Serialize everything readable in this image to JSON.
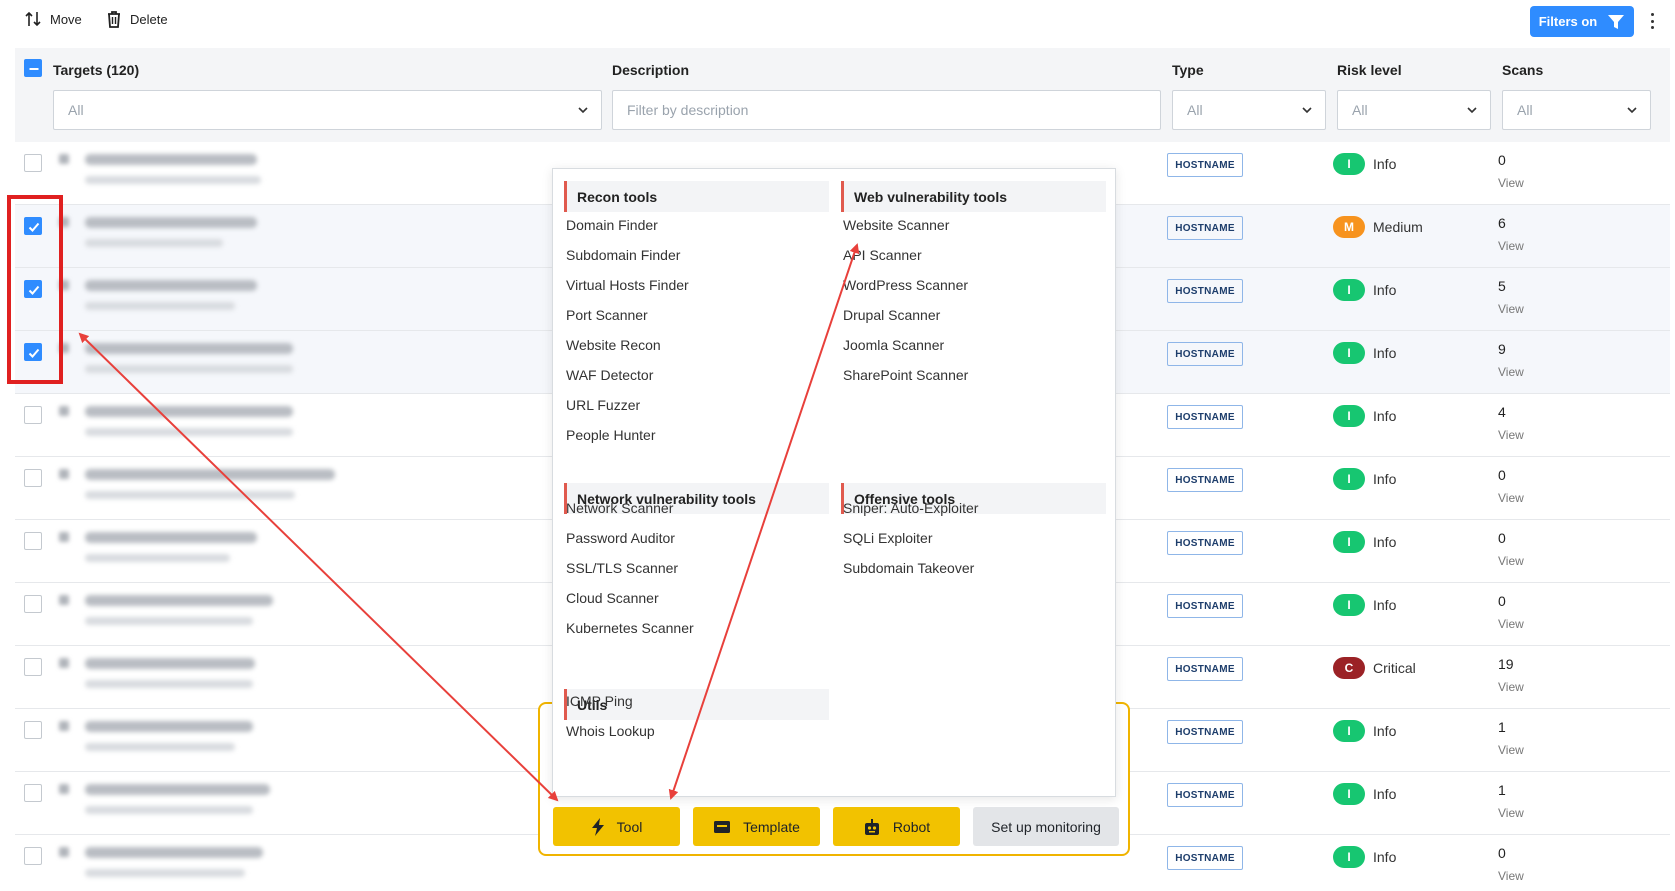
{
  "toolbar": {
    "move_label": "Move",
    "delete_label": "Delete",
    "filters_label": "Filters on"
  },
  "table": {
    "headers": {
      "targets": "Targets (120)",
      "description": "Description",
      "type": "Type",
      "risk": "Risk level",
      "scans": "Scans"
    },
    "filters": {
      "targets": "All",
      "description_placeholder": "Filter by description",
      "type": "All",
      "risk": "All",
      "scans": "All"
    },
    "rows": [
      {
        "checked": false,
        "type": "HOSTNAME",
        "risk_letter": "I",
        "risk_label": "Info",
        "risk_color": "#17c671",
        "scans": "0",
        "view": "View"
      },
      {
        "checked": true,
        "type": "HOSTNAME",
        "risk_letter": "M",
        "risk_label": "Medium",
        "risk_color": "#f7931e",
        "scans": "6",
        "view": "View"
      },
      {
        "checked": true,
        "type": "HOSTNAME",
        "risk_letter": "I",
        "risk_label": "Info",
        "risk_color": "#17c671",
        "scans": "5",
        "view": "View"
      },
      {
        "checked": true,
        "type": "HOSTNAME",
        "risk_letter": "I",
        "risk_label": "Info",
        "risk_color": "#17c671",
        "scans": "9",
        "view": "View"
      },
      {
        "checked": false,
        "type": "HOSTNAME",
        "risk_letter": "I",
        "risk_label": "Info",
        "risk_color": "#17c671",
        "scans": "4",
        "view": "View"
      },
      {
        "checked": false,
        "type": "HOSTNAME",
        "risk_letter": "I",
        "risk_label": "Info",
        "risk_color": "#17c671",
        "scans": "0",
        "view": "View"
      },
      {
        "checked": false,
        "type": "HOSTNAME",
        "risk_letter": "I",
        "risk_label": "Info",
        "risk_color": "#17c671",
        "scans": "0",
        "view": "View"
      },
      {
        "checked": false,
        "type": "HOSTNAME",
        "risk_letter": "I",
        "risk_label": "Info",
        "risk_color": "#17c671",
        "scans": "0",
        "view": "View"
      },
      {
        "checked": false,
        "type": "HOSTNAME",
        "risk_letter": "C",
        "risk_label": "Critical",
        "risk_color": "#9b2226",
        "scans": "19",
        "view": "View"
      },
      {
        "checked": false,
        "type": "HOSTNAME",
        "risk_letter": "I",
        "risk_label": "Info",
        "risk_color": "#17c671",
        "scans": "1",
        "view": "View"
      },
      {
        "checked": false,
        "type": "HOSTNAME",
        "risk_letter": "I",
        "risk_label": "Info",
        "risk_color": "#17c671",
        "scans": "1",
        "view": "View"
      },
      {
        "checked": false,
        "type": "HOSTNAME",
        "risk_letter": "I",
        "risk_label": "Info",
        "risk_color": "#17c671",
        "scans": "0",
        "view": "View"
      }
    ]
  },
  "menu": {
    "recon": {
      "title": "Recon tools",
      "items": [
        "Domain Finder",
        "Subdomain Finder",
        "Virtual Hosts Finder",
        "Port Scanner",
        "Website Recon",
        "WAF Detector",
        "URL Fuzzer",
        "People Hunter"
      ]
    },
    "web": {
      "title": "Web vulnerability tools",
      "items": [
        "Website Scanner",
        "API Scanner",
        "WordPress Scanner",
        "Drupal Scanner",
        "Joomla Scanner",
        "SharePoint Scanner"
      ]
    },
    "network": {
      "title": "Network vulnerability tools",
      "items": [
        "Network Scanner",
        "Password Auditor",
        "SSL/TLS Scanner",
        "Cloud Scanner",
        "Kubernetes Scanner"
      ]
    },
    "offensive": {
      "title": "Offensive tools",
      "items": [
        "Sniper: Auto-Exploiter",
        "SQLi Exploiter",
        "Subdomain Takeover"
      ]
    },
    "utils": {
      "title": "Utils",
      "items": [
        "ICMP Ping",
        "Whois Lookup"
      ]
    }
  },
  "actions": {
    "tool": "Tool",
    "template": "Template",
    "robot": "Robot",
    "monitoring": "Set up monitoring"
  },
  "colors": {
    "primary": "#2f8cff",
    "action_yellow": "#f2c200",
    "annotation_red": "#e02020"
  }
}
